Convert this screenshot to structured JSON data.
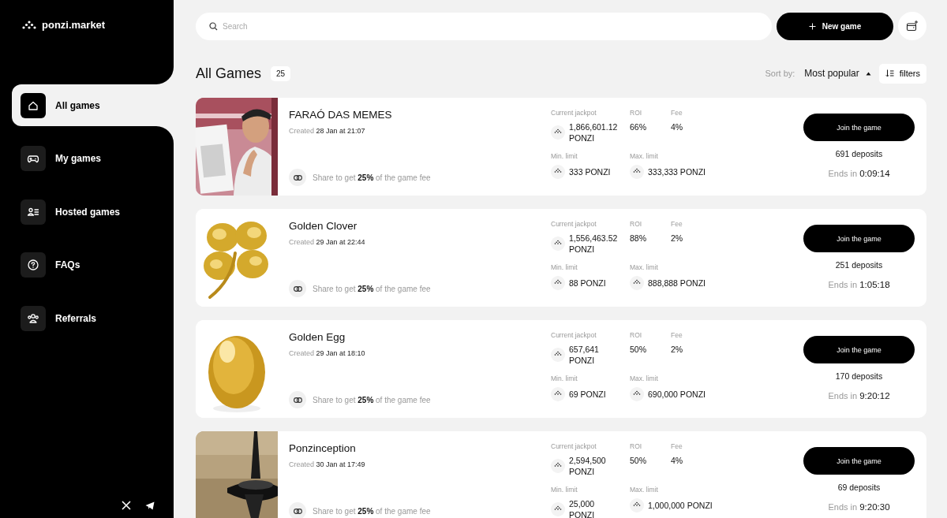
{
  "sidebar": {
    "logo": "ponzi.market",
    "items": [
      {
        "label": "All games",
        "selected": true
      },
      {
        "label": "My games",
        "selected": false
      },
      {
        "label": "Hosted games",
        "selected": false
      },
      {
        "label": "FAQs",
        "selected": false
      },
      {
        "label": "Referrals",
        "selected": false
      }
    ]
  },
  "search": {
    "placeholder": "Search"
  },
  "new_game_button": "New game",
  "heading": {
    "title": "All Games",
    "count": "25"
  },
  "sort": {
    "label": "Sort by:",
    "value": "Most popular",
    "filters": "filters"
  },
  "games": [
    {
      "name": "FARAÓ DAS MEMES",
      "created_label": "Created",
      "created": "28 Jan at 21:07",
      "share": "Share to get **25%** of the game fee",
      "jackpot_label": "Current jackpot",
      "jackpot": "1,866,601.12 PONZI",
      "roi_label": "ROI",
      "roi": "66%",
      "fee_label": "Fee",
      "fee": "4%",
      "min_label": "Min. limit",
      "min": "333 PONZI",
      "max_label": "Max. limit",
      "max": "333,333 PONZI",
      "button": "Join the game",
      "deposits": "691 deposits",
      "ends_label": "Ends in",
      "ends": "0:09:14"
    },
    {
      "name": "Golden Clover",
      "created_label": "Created",
      "created": "29 Jan at 22:44",
      "share": "Share to get **25%** of the game fee",
      "jackpot_label": "Current jackpot",
      "jackpot": "1,556,463.52 PONZI",
      "roi_label": "ROI",
      "roi": "88%",
      "fee_label": "Fee",
      "fee": "2%",
      "min_label": "Min. limit",
      "min": "88 PONZI",
      "max_label": "Max. limit",
      "max": "888,888 PONZI",
      "button": "Join the game",
      "deposits": "251 deposits",
      "ends_label": "Ends in",
      "ends": "1:05:18"
    },
    {
      "name": "Golden Egg",
      "created_label": "Created",
      "created": "29 Jan at 18:10",
      "share": "Share to get **25%** of the game fee",
      "jackpot_label": "Current jackpot",
      "jackpot": "657,641 PONZI",
      "roi_label": "ROI",
      "roi": "50%",
      "fee_label": "Fee",
      "fee": "2%",
      "min_label": "Min. limit",
      "min": "69 PONZI",
      "max_label": "Max. limit",
      "max": "690,000 PONZI",
      "button": "Join the game",
      "deposits": "170 deposits",
      "ends_label": "Ends in",
      "ends": "9:20:12"
    },
    {
      "name": "Ponzinception",
      "created_label": "Created",
      "created": "30 Jan at 17:49",
      "share": "Share to get **25%** of the game fee",
      "jackpot_label": "Current jackpot",
      "jackpot": "2,594,500 PONZI",
      "roi_label": "ROI",
      "roi": "50%",
      "fee_label": "Fee",
      "fee": "4%",
      "min_label": "Min. limit",
      "min": "25,000 PONZI",
      "max_label": "Max. limit",
      "max": "1,000,000 PONZI",
      "button": "Join the game",
      "deposits": "69 deposits",
      "ends_label": "Ends in",
      "ends": "9:20:30"
    }
  ]
}
